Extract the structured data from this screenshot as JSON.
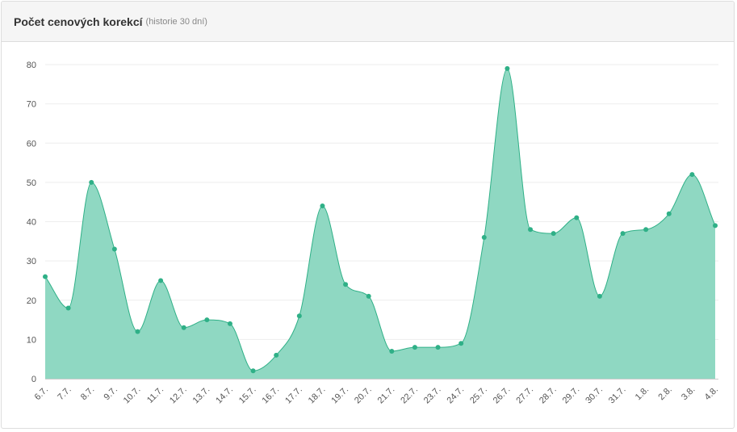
{
  "panel": {
    "title": "Počet cenových korekcí",
    "subtitle": "(historie 30 dní)"
  },
  "colors": {
    "line": "#2fb087",
    "fill": "#8fd8c2",
    "point": "#2fb087",
    "grid": "#eeeeee",
    "axis_text": "#555555"
  },
  "chart_data": {
    "type": "area",
    "title": "Počet cenových korekcí",
    "subtitle": "(historie 30 dní)",
    "xlabel": "",
    "ylabel": "",
    "ylim": [
      0,
      80
    ],
    "y_ticks": [
      0,
      10,
      20,
      30,
      40,
      50,
      60,
      70,
      80
    ],
    "grid": true,
    "categories": [
      "6.7.",
      "7.7.",
      "8.7.",
      "9.7.",
      "10.7.",
      "11.7.",
      "12.7.",
      "13.7.",
      "14.7.",
      "15.7.",
      "16.7.",
      "17.7.",
      "18.7.",
      "19.7.",
      "20.7.",
      "21.7.",
      "22.7.",
      "23.7.",
      "24.7.",
      "25.7.",
      "26.7.",
      "27.7.",
      "28.7.",
      "29.7.",
      "30.7.",
      "31.7.",
      "1.8.",
      "2.8.",
      "3.8.",
      "4.8."
    ],
    "values": [
      26,
      18,
      50,
      33,
      12,
      25,
      13,
      15,
      14,
      2,
      6,
      16,
      44,
      24,
      21,
      7,
      8,
      8,
      9,
      36,
      79,
      38,
      37,
      41,
      21,
      37,
      38,
      42,
      52,
      39
    ]
  }
}
